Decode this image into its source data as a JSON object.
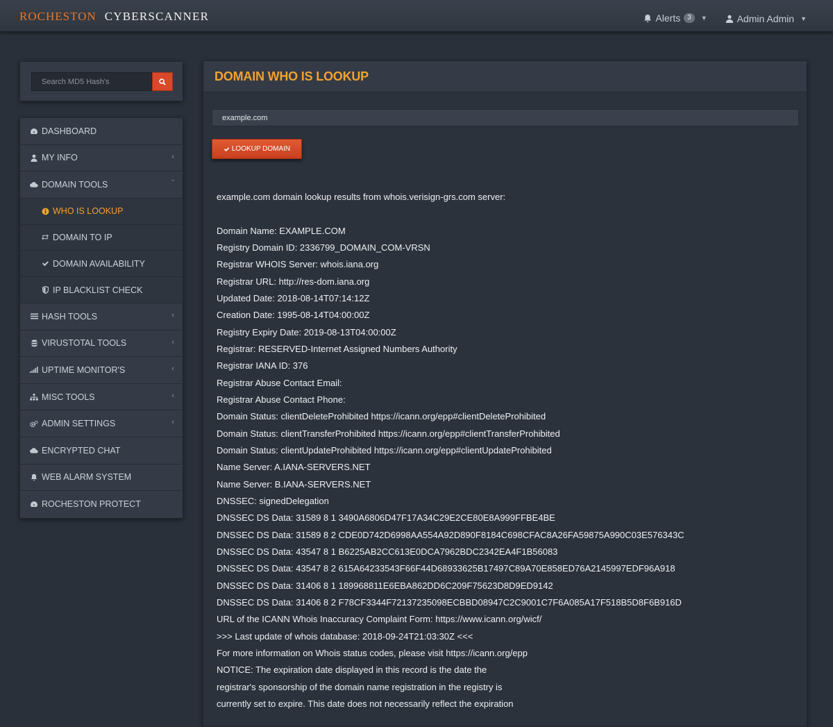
{
  "brand": {
    "part1": "ROCHESTON",
    "part2": "CYBERSCANNER"
  },
  "topnav": {
    "alerts_label": "Alerts",
    "alerts_count": "3",
    "user_label": "Admin Admin"
  },
  "search": {
    "placeholder": "Search MD5 Hash's"
  },
  "menu": [
    {
      "label": "DASHBOARD",
      "icon": "dashboard-icon"
    },
    {
      "label": "MY INFO",
      "icon": "user-icon"
    },
    {
      "label": "DOMAIN TOOLS",
      "icon": "cloud-icon"
    },
    {
      "label": "WHO IS LOOKUP",
      "icon": "info-icon"
    },
    {
      "label": "DOMAIN TO IP",
      "icon": "retweet-icon"
    },
    {
      "label": "DOMAIN AVAILABILITY",
      "icon": "check-icon"
    },
    {
      "label": "IP BLACKLIST CHECK",
      "icon": "shield-icon"
    },
    {
      "label": "HASH TOOLS",
      "icon": "list-icon"
    },
    {
      "label": "VIRUSTOTAL TOOLS",
      "icon": "database-icon"
    },
    {
      "label": "UPTIME MONITOR'S",
      "icon": "signal-icon"
    },
    {
      "label": "MISC TOOLS",
      "icon": "sitemap-icon"
    },
    {
      "label": "ADMIN SETTINGS",
      "icon": "cogs-icon"
    },
    {
      "label": "ENCRYPTED CHAT",
      "icon": "cloud-icon"
    },
    {
      "label": "WEB ALARM SYSTEM",
      "icon": "bell-icon"
    },
    {
      "label": "ROCHESTON PROTECT",
      "icon": "dashboard-icon"
    }
  ],
  "panel": {
    "title": "DOMAIN WHO IS LOOKUP",
    "domain_value": "example.com",
    "lookup_button": "LOOKUP DOMAIN"
  },
  "results": {
    "intro": "example.com domain lookup results from whois.verisign-grs.com server:",
    "lines": [
      "Domain Name: EXAMPLE.COM",
      "Registry Domain ID: 2336799_DOMAIN_COM-VRSN",
      "Registrar WHOIS Server: whois.iana.org",
      "Registrar URL: http://res-dom.iana.org",
      "Updated Date: 2018-08-14T07:14:12Z",
      "Creation Date: 1995-08-14T04:00:00Z",
      "Registry Expiry Date: 2019-08-13T04:00:00Z",
      "Registrar: RESERVED-Internet Assigned Numbers Authority",
      "Registrar IANA ID: 376",
      "Registrar Abuse Contact Email:",
      "Registrar Abuse Contact Phone:",
      "Domain Status: clientDeleteProhibited https://icann.org/epp#clientDeleteProhibited",
      "Domain Status: clientTransferProhibited https://icann.org/epp#clientTransferProhibited",
      "Domain Status: clientUpdateProhibited https://icann.org/epp#clientUpdateProhibited",
      "Name Server: A.IANA-SERVERS.NET",
      "Name Server: B.IANA-SERVERS.NET",
      "DNSSEC: signedDelegation",
      "DNSSEC DS Data: 31589 8 1 3490A6806D47F17A34C29E2CE80E8A999FFBE4BE",
      "DNSSEC DS Data: 31589 8 2 CDE0D742D6998AA554A92D890F8184C698CFAC8A26FA59875A990C03E576343C",
      "DNSSEC DS Data: 43547 8 1 B6225AB2CC613E0DCA7962BDC2342EA4F1B56083",
      "DNSSEC DS Data: 43547 8 2 615A64233543F66F44D68933625B17497C89A70E858ED76A2145997EDF96A918",
      "DNSSEC DS Data: 31406 8 1 189968811E6EBA862DD6C209F75623D8D9ED9142",
      "DNSSEC DS Data: 31406 8 2 F78CF3344F72137235098ECBBD08947C2C9001C7F6A085A17F518B5D8F6B916D",
      "URL of the ICANN Whois Inaccuracy Complaint Form: https://www.icann.org/wicf/",
      ">>> Last update of whois database: 2018-09-24T21:03:30Z <<<",
      "For more information on Whois status codes, please visit https://icann.org/epp",
      "NOTICE: The expiration date displayed in this record is the date the",
      "registrar's sponsorship of the domain name registration in the registry is",
      "currently set to expire. This date does not necessarily reflect the expiration"
    ]
  }
}
